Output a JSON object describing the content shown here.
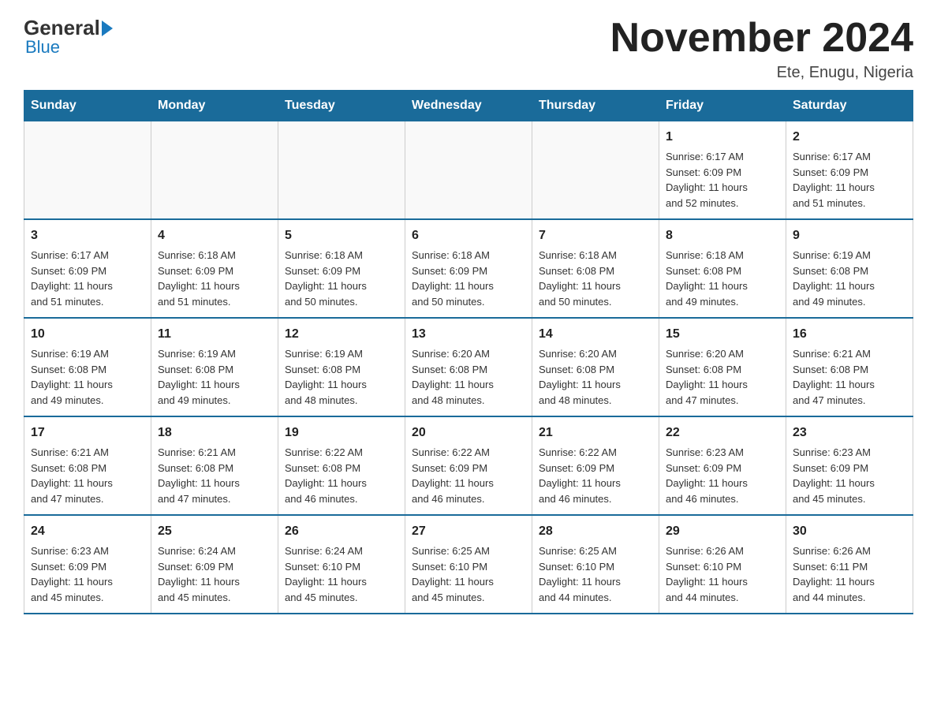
{
  "logo": {
    "general": "General",
    "blue": "Blue"
  },
  "title": "November 2024",
  "subtitle": "Ete, Enugu, Nigeria",
  "weekdays": [
    "Sunday",
    "Monday",
    "Tuesday",
    "Wednesday",
    "Thursday",
    "Friday",
    "Saturday"
  ],
  "weeks": [
    [
      {
        "day": "",
        "info": ""
      },
      {
        "day": "",
        "info": ""
      },
      {
        "day": "",
        "info": ""
      },
      {
        "day": "",
        "info": ""
      },
      {
        "day": "",
        "info": ""
      },
      {
        "day": "1",
        "info": "Sunrise: 6:17 AM\nSunset: 6:09 PM\nDaylight: 11 hours\nand 52 minutes."
      },
      {
        "day": "2",
        "info": "Sunrise: 6:17 AM\nSunset: 6:09 PM\nDaylight: 11 hours\nand 51 minutes."
      }
    ],
    [
      {
        "day": "3",
        "info": "Sunrise: 6:17 AM\nSunset: 6:09 PM\nDaylight: 11 hours\nand 51 minutes."
      },
      {
        "day": "4",
        "info": "Sunrise: 6:18 AM\nSunset: 6:09 PM\nDaylight: 11 hours\nand 51 minutes."
      },
      {
        "day": "5",
        "info": "Sunrise: 6:18 AM\nSunset: 6:09 PM\nDaylight: 11 hours\nand 50 minutes."
      },
      {
        "day": "6",
        "info": "Sunrise: 6:18 AM\nSunset: 6:09 PM\nDaylight: 11 hours\nand 50 minutes."
      },
      {
        "day": "7",
        "info": "Sunrise: 6:18 AM\nSunset: 6:08 PM\nDaylight: 11 hours\nand 50 minutes."
      },
      {
        "day": "8",
        "info": "Sunrise: 6:18 AM\nSunset: 6:08 PM\nDaylight: 11 hours\nand 49 minutes."
      },
      {
        "day": "9",
        "info": "Sunrise: 6:19 AM\nSunset: 6:08 PM\nDaylight: 11 hours\nand 49 minutes."
      }
    ],
    [
      {
        "day": "10",
        "info": "Sunrise: 6:19 AM\nSunset: 6:08 PM\nDaylight: 11 hours\nand 49 minutes."
      },
      {
        "day": "11",
        "info": "Sunrise: 6:19 AM\nSunset: 6:08 PM\nDaylight: 11 hours\nand 49 minutes."
      },
      {
        "day": "12",
        "info": "Sunrise: 6:19 AM\nSunset: 6:08 PM\nDaylight: 11 hours\nand 48 minutes."
      },
      {
        "day": "13",
        "info": "Sunrise: 6:20 AM\nSunset: 6:08 PM\nDaylight: 11 hours\nand 48 minutes."
      },
      {
        "day": "14",
        "info": "Sunrise: 6:20 AM\nSunset: 6:08 PM\nDaylight: 11 hours\nand 48 minutes."
      },
      {
        "day": "15",
        "info": "Sunrise: 6:20 AM\nSunset: 6:08 PM\nDaylight: 11 hours\nand 47 minutes."
      },
      {
        "day": "16",
        "info": "Sunrise: 6:21 AM\nSunset: 6:08 PM\nDaylight: 11 hours\nand 47 minutes."
      }
    ],
    [
      {
        "day": "17",
        "info": "Sunrise: 6:21 AM\nSunset: 6:08 PM\nDaylight: 11 hours\nand 47 minutes."
      },
      {
        "day": "18",
        "info": "Sunrise: 6:21 AM\nSunset: 6:08 PM\nDaylight: 11 hours\nand 47 minutes."
      },
      {
        "day": "19",
        "info": "Sunrise: 6:22 AM\nSunset: 6:08 PM\nDaylight: 11 hours\nand 46 minutes."
      },
      {
        "day": "20",
        "info": "Sunrise: 6:22 AM\nSunset: 6:09 PM\nDaylight: 11 hours\nand 46 minutes."
      },
      {
        "day": "21",
        "info": "Sunrise: 6:22 AM\nSunset: 6:09 PM\nDaylight: 11 hours\nand 46 minutes."
      },
      {
        "day": "22",
        "info": "Sunrise: 6:23 AM\nSunset: 6:09 PM\nDaylight: 11 hours\nand 46 minutes."
      },
      {
        "day": "23",
        "info": "Sunrise: 6:23 AM\nSunset: 6:09 PM\nDaylight: 11 hours\nand 45 minutes."
      }
    ],
    [
      {
        "day": "24",
        "info": "Sunrise: 6:23 AM\nSunset: 6:09 PM\nDaylight: 11 hours\nand 45 minutes."
      },
      {
        "day": "25",
        "info": "Sunrise: 6:24 AM\nSunset: 6:09 PM\nDaylight: 11 hours\nand 45 minutes."
      },
      {
        "day": "26",
        "info": "Sunrise: 6:24 AM\nSunset: 6:10 PM\nDaylight: 11 hours\nand 45 minutes."
      },
      {
        "day": "27",
        "info": "Sunrise: 6:25 AM\nSunset: 6:10 PM\nDaylight: 11 hours\nand 45 minutes."
      },
      {
        "day": "28",
        "info": "Sunrise: 6:25 AM\nSunset: 6:10 PM\nDaylight: 11 hours\nand 44 minutes."
      },
      {
        "day": "29",
        "info": "Sunrise: 6:26 AM\nSunset: 6:10 PM\nDaylight: 11 hours\nand 44 minutes."
      },
      {
        "day": "30",
        "info": "Sunrise: 6:26 AM\nSunset: 6:11 PM\nDaylight: 11 hours\nand 44 minutes."
      }
    ]
  ]
}
